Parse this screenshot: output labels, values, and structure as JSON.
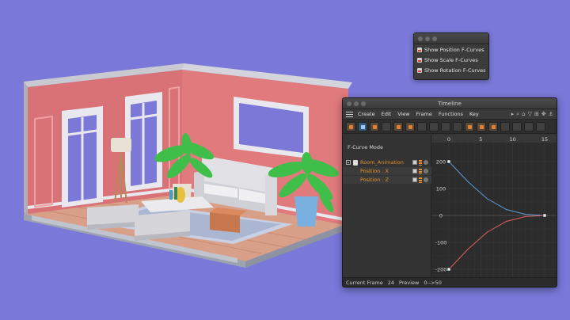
{
  "popup": {
    "items": [
      {
        "label": "Show Position F-Curves"
      },
      {
        "label": "Show Scale F-Curves"
      },
      {
        "label": "Show Rotation F-Curves"
      }
    ]
  },
  "timeline": {
    "title": "Timeline",
    "menu": [
      "Create",
      "Edit",
      "View",
      "Frame",
      "Functions",
      "Key"
    ],
    "mode_label": "F-Curve Mode",
    "tracks": {
      "root": "Room_Animation",
      "children": [
        "Position . X",
        "Position . Z"
      ]
    },
    "status": {
      "current_frame_label": "Current Frame",
      "current_frame_value": "24",
      "preview_label": "Preview",
      "preview_value": "0-->50"
    }
  },
  "chart_data": {
    "type": "line",
    "x_ticks": [
      "0",
      "5",
      "10",
      "15"
    ],
    "y_ticks": [
      "200",
      "100",
      "0",
      "-100",
      "-200"
    ],
    "xlim": [
      0,
      15
    ],
    "ylim": [
      -200,
      200
    ],
    "series": [
      {
        "name": "Position . X",
        "color": "#5b9bd5",
        "x": [
          0,
          3,
          6,
          9,
          12,
          15
        ],
        "y": [
          200,
          125,
          62,
          22,
          4,
          0
        ]
      },
      {
        "name": "Position . Z",
        "color": "#e06060",
        "x": [
          0,
          3,
          6,
          9,
          12,
          15
        ],
        "y": [
          -200,
          -125,
          -62,
          -22,
          -4,
          0
        ]
      }
    ]
  },
  "colors": {
    "background": "#7a78d8",
    "track_orange": "#e8902a",
    "curve_x": "#5b9bd5",
    "curve_z": "#e06060"
  }
}
